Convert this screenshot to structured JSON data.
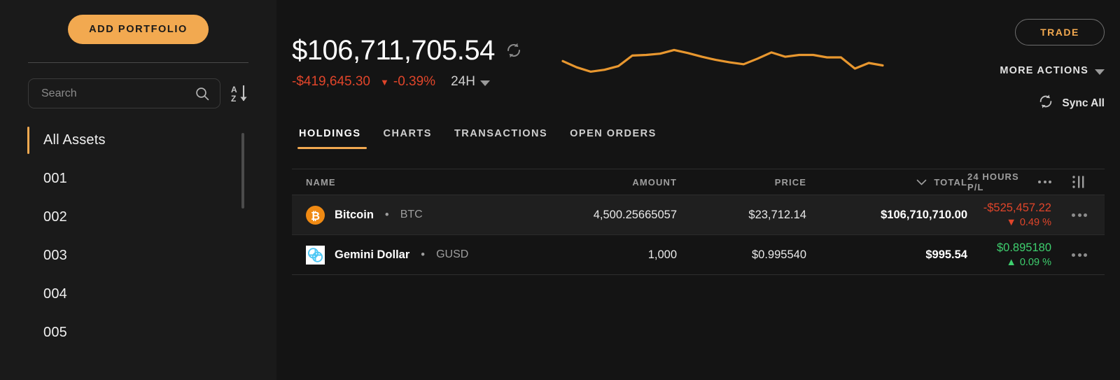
{
  "sidebar": {
    "add_portfolio_label": "ADD PORTFOLIO",
    "search": {
      "placeholder": "Search",
      "value": "",
      "icon": "search-icon"
    },
    "sort_icon": "sort-az-icon",
    "items": [
      {
        "label": "All Assets",
        "active": true
      },
      {
        "label": "001",
        "active": false
      },
      {
        "label": "002",
        "active": false
      },
      {
        "label": "003",
        "active": false
      },
      {
        "label": "004",
        "active": false
      },
      {
        "label": "005",
        "active": false
      }
    ]
  },
  "header": {
    "total_value": "$106,711,705.54",
    "refresh_icon": "refresh-icon",
    "change_amount": "-$419,645.30",
    "change_percent": "-0.39%",
    "change_direction": "down",
    "change_caret": "▼",
    "range_label": "24H",
    "trade_label": "TRADE",
    "more_actions_label": "MORE ACTIONS",
    "sync_all_label": "Sync All",
    "sync_icon": "sync-icon",
    "accent_color": "#f2a950",
    "negative_color": "#e0452a",
    "positive_color": "#3ecf6e"
  },
  "tabs": [
    {
      "label": "HOLDINGS",
      "active": true
    },
    {
      "label": "CHARTS",
      "active": false
    },
    {
      "label": "TRANSACTIONS",
      "active": false
    },
    {
      "label": "OPEN ORDERS",
      "active": false
    }
  ],
  "table": {
    "columns": {
      "name": "NAME",
      "amount": "AMOUNT",
      "price": "PRICE",
      "total": "TOTAL",
      "pl": "24 HOURS P/L"
    },
    "total_sorted": true,
    "rows": [
      {
        "icon": "bitcoin-icon",
        "name": "Bitcoin",
        "symbol": "BTC",
        "amount": "4,500.25665057",
        "price": "$23,712.14",
        "total": "$106,710,710.00",
        "pl_value": "-$525,457.22",
        "pl_percent": "0.49 %",
        "pl_caret": "▼",
        "pl_direction": "down"
      },
      {
        "icon": "gemini-dollar-icon",
        "name": "Gemini Dollar",
        "symbol": "GUSD",
        "amount": "1,000",
        "price": "$0.995540",
        "total": "$995.54",
        "pl_value": "$0.895180",
        "pl_percent": "0.09 %",
        "pl_caret": "▲",
        "pl_direction": "up"
      }
    ]
  },
  "chart_data": {
    "type": "line",
    "title": "",
    "xlabel": "",
    "ylabel": "",
    "legend": [],
    "grid": false,
    "color": "#e8972f",
    "x": [
      0,
      1,
      2,
      3,
      4,
      5,
      6,
      7,
      8,
      9,
      10,
      11,
      12,
      13,
      14,
      15,
      16,
      17,
      18,
      19,
      20,
      21,
      22,
      23
    ],
    "values": [
      38,
      28,
      21,
      24,
      30,
      47,
      48,
      50,
      56,
      51,
      45,
      40,
      36,
      33,
      42,
      52,
      45,
      48,
      48,
      44,
      44,
      26,
      35,
      31
    ],
    "ylim": [
      0,
      70
    ]
  }
}
